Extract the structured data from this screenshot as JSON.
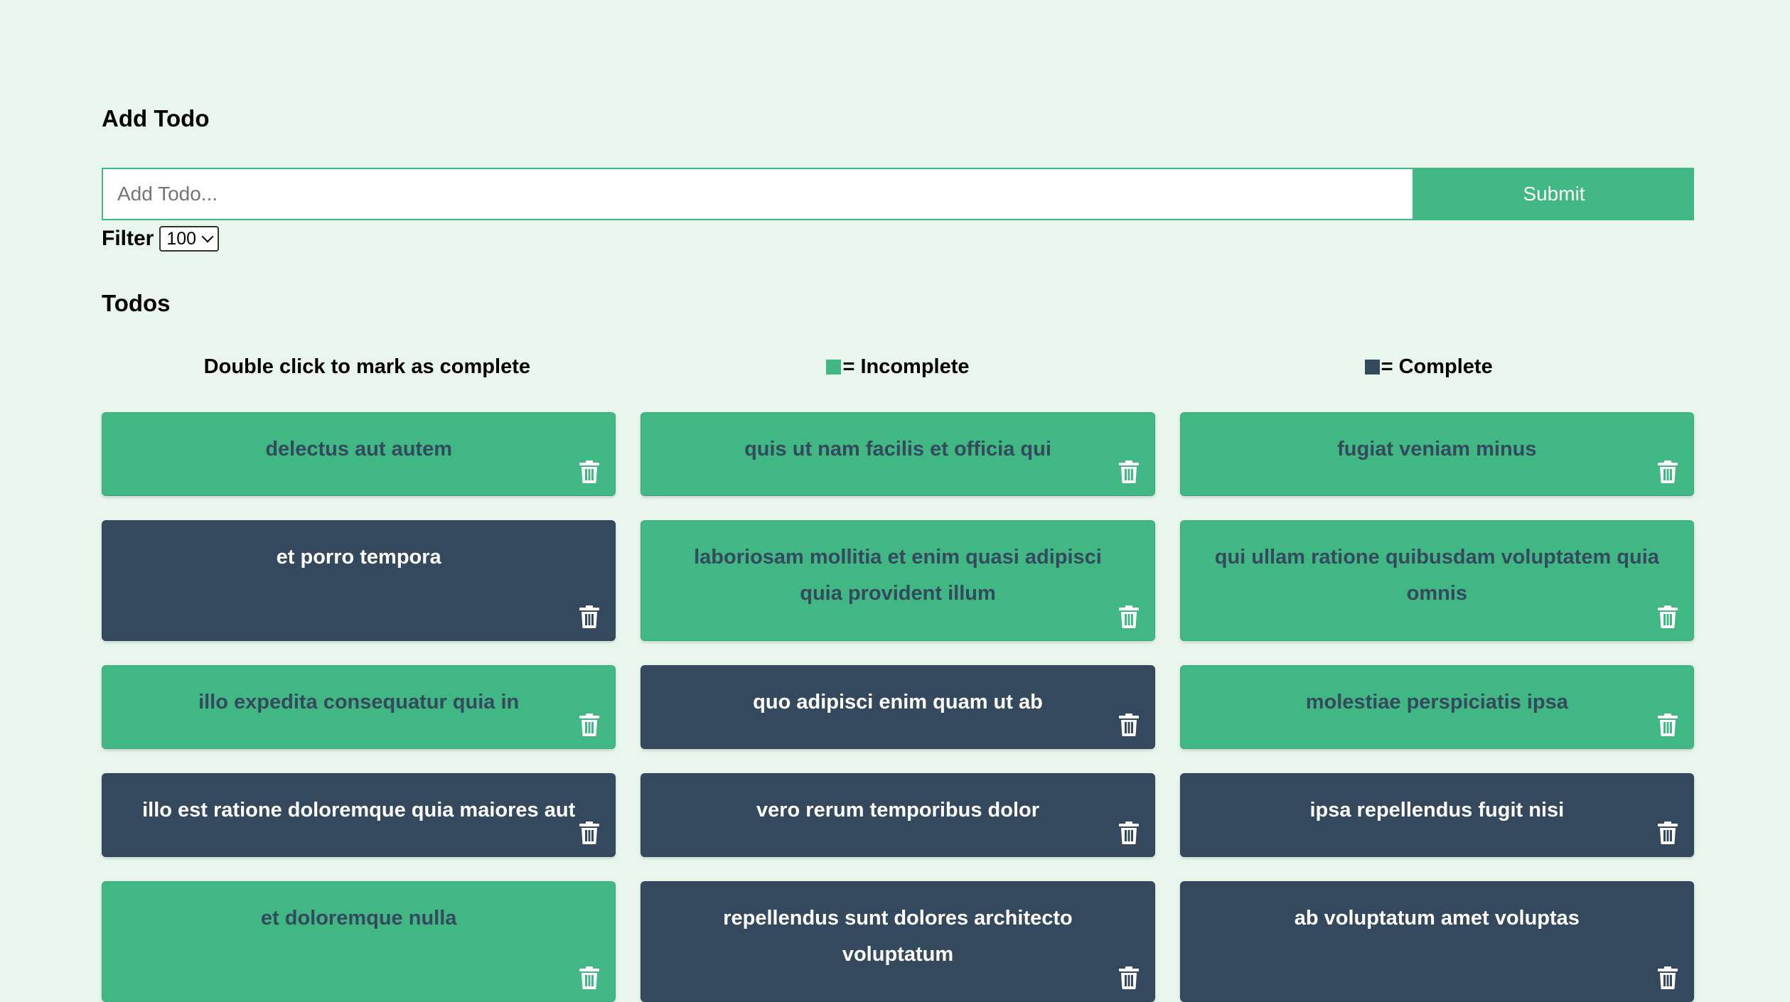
{
  "add_section": {
    "heading": "Add Todo",
    "input_placeholder": "Add Todo...",
    "input_value": "",
    "submit_label": "Submit"
  },
  "filter": {
    "label": "Filter",
    "selected": "100"
  },
  "todos_section": {
    "heading": "Todos"
  },
  "legend": {
    "instruction": "Double click to mark as complete",
    "incomplete_label": "= Incomplete",
    "complete_label": "= Complete"
  },
  "colors": {
    "incomplete": "#41b883",
    "complete": "#35495e",
    "background": "#e8f6ee"
  },
  "todos": [
    {
      "title": "delectus aut autem",
      "completed": false
    },
    {
      "title": "quis ut nam facilis et officia qui",
      "completed": false
    },
    {
      "title": "fugiat veniam minus",
      "completed": false
    },
    {
      "title": "et porro tempora",
      "completed": true
    },
    {
      "title": "laboriosam mollitia et enim quasi adipisci quia provident illum",
      "completed": false
    },
    {
      "title": "qui ullam ratione quibusdam voluptatem quia omnis",
      "completed": false
    },
    {
      "title": "illo expedita consequatur quia in",
      "completed": false
    },
    {
      "title": "quo adipisci enim quam ut ab",
      "completed": true
    },
    {
      "title": "molestiae perspiciatis ipsa",
      "completed": false
    },
    {
      "title": "illo est ratione doloremque quia maiores aut",
      "completed": true
    },
    {
      "title": "vero rerum temporibus dolor",
      "completed": true
    },
    {
      "title": "ipsa repellendus fugit nisi",
      "completed": true
    },
    {
      "title": "et doloremque nulla",
      "completed": false
    },
    {
      "title": "repellendus sunt dolores architecto voluptatum",
      "completed": true
    },
    {
      "title": "ab voluptatum amet voluptas",
      "completed": true
    }
  ]
}
